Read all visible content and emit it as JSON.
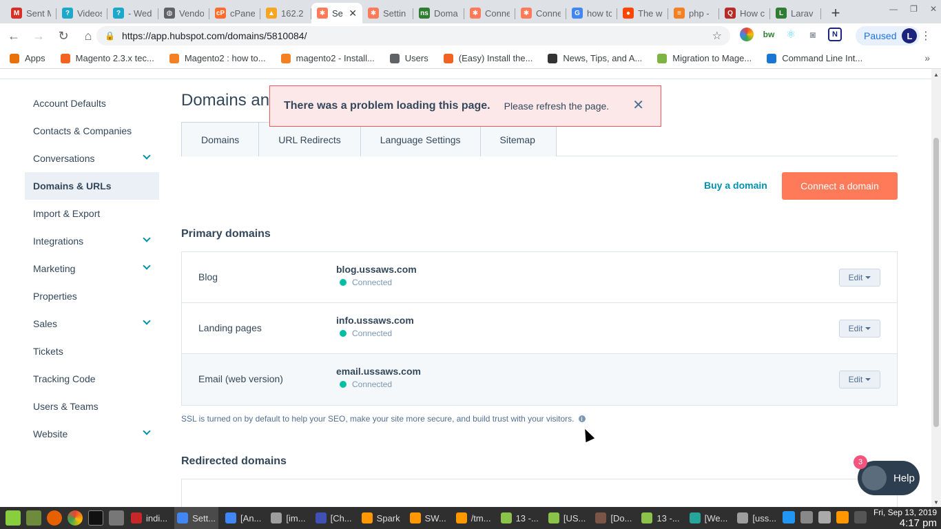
{
  "browser": {
    "tabs": [
      {
        "label": "Sent M",
        "color": "#d93025",
        "glyph": "M"
      },
      {
        "label": "Videos",
        "color": "#1ca9c9",
        "glyph": "?"
      },
      {
        "label": "- Wed",
        "color": "#1ca9c9",
        "glyph": "?"
      },
      {
        "label": "Vendo",
        "color": "#5f6368",
        "glyph": "◍"
      },
      {
        "label": "cPane",
        "color": "#ff6c2c",
        "glyph": "cP"
      },
      {
        "label": "162.2",
        "color": "#f5a623",
        "glyph": "▲"
      },
      {
        "label": "Se",
        "color": "#ff7a59",
        "glyph": "✱",
        "active": true
      },
      {
        "label": "Settin",
        "color": "#ff7a59",
        "glyph": "✱"
      },
      {
        "label": "Doma",
        "color": "#2e7d32",
        "glyph": "ns"
      },
      {
        "label": "Conne",
        "color": "#ff7a59",
        "glyph": "✱"
      },
      {
        "label": "Conne",
        "color": "#ff7a59",
        "glyph": "✱"
      },
      {
        "label": "how tc",
        "color": "#4285f4",
        "glyph": "G"
      },
      {
        "label": "The w",
        "color": "#ff4500",
        "glyph": "●"
      },
      {
        "label": "php -",
        "color": "#f48024",
        "glyph": "≡"
      },
      {
        "label": "How c",
        "color": "#b92b27",
        "glyph": "Q"
      },
      {
        "label": "Larav",
        "color": "#2e7d32",
        "glyph": "L"
      }
    ],
    "url": "https://app.hubspot.com/domains/5810084/",
    "profile_status": "Paused",
    "profile_initial": "L",
    "bookmarks": [
      {
        "label": "Apps",
        "color": "#e8710a"
      },
      {
        "label": "Magento 2.3.x tec...",
        "color": "#f26322"
      },
      {
        "label": "Magento2 : how to...",
        "color": "#f48024"
      },
      {
        "label": "magento2 - Install...",
        "color": "#f48024"
      },
      {
        "label": "Users",
        "color": "#5f6368"
      },
      {
        "label": "(Easy) Install the...",
        "color": "#f26322"
      },
      {
        "label": "News, Tips, and A...",
        "color": "#333333"
      },
      {
        "label": "Migration to Mage...",
        "color": "#7cb342"
      },
      {
        "label": "Command Line Int...",
        "color": "#1976d2"
      }
    ]
  },
  "sidebar": {
    "items": [
      {
        "label": "Account Defaults",
        "expandable": false
      },
      {
        "label": "Contacts & Companies",
        "expandable": false
      },
      {
        "label": "Conversations",
        "expandable": true
      },
      {
        "label": "Domains & URLs",
        "expandable": false,
        "active": true
      },
      {
        "label": "Import & Export",
        "expandable": false
      },
      {
        "label": "Integrations",
        "expandable": true
      },
      {
        "label": "Marketing",
        "expandable": true
      },
      {
        "label": "Properties",
        "expandable": false
      },
      {
        "label": "Sales",
        "expandable": true
      },
      {
        "label": "Tickets",
        "expandable": false
      },
      {
        "label": "Tracking Code",
        "expandable": false
      },
      {
        "label": "Users & Teams",
        "expandable": false
      },
      {
        "label": "Website",
        "expandable": true
      }
    ]
  },
  "main": {
    "title": "Domains an",
    "tabs": [
      "Domains",
      "URL Redirects",
      "Language Settings",
      "Sitemap"
    ],
    "buy_domain": "Buy a domain",
    "connect_domain": "Connect a domain",
    "primary_title": "Primary domains",
    "domains": [
      {
        "type": "Blog",
        "domain": "blog.ussaws.com",
        "status": "Connected",
        "edit": "Edit"
      },
      {
        "type": "Landing pages",
        "domain": "info.ussaws.com",
        "status": "Connected",
        "edit": "Edit"
      },
      {
        "type": "Email (web version)",
        "domain": "email.ussaws.com",
        "status": "Connected",
        "edit": "Edit"
      }
    ],
    "ssl_note": "SSL is turned on by default to help your SEO, make your site more secure, and build trust with your visitors.",
    "redirected_title": "Redirected domains"
  },
  "alert": {
    "title": "There was a problem loading this page.",
    "message": "Please refresh the page."
  },
  "help": {
    "label": "Help",
    "badge": "3"
  },
  "taskbar": {
    "items": [
      {
        "label": "indi...",
        "color": "#c62828"
      },
      {
        "label": "Sett...",
        "color": "#4285f4",
        "active": true
      },
      {
        "label": "[An...",
        "color": "#4285f4"
      },
      {
        "label": "[im...",
        "color": "#9e9e9e"
      },
      {
        "label": "[Ch...",
        "color": "#3f51b5"
      },
      {
        "label": "Spark",
        "color": "#ff9800"
      },
      {
        "label": "SW...",
        "color": "#ff9800"
      },
      {
        "label": "/tm...",
        "color": "#ff9800"
      },
      {
        "label": "13 -...",
        "color": "#8bc34a"
      },
      {
        "label": "[US...",
        "color": "#8bc34a"
      },
      {
        "label": "[Do...",
        "color": "#795548"
      },
      {
        "label": "13 -...",
        "color": "#8bc34a"
      },
      {
        "label": "[We...",
        "color": "#26a69a"
      },
      {
        "label": "[uss...",
        "color": "#9e9e9e"
      }
    ],
    "date": "Fri, Sep 13, 2019",
    "time": "4:17 pm"
  }
}
